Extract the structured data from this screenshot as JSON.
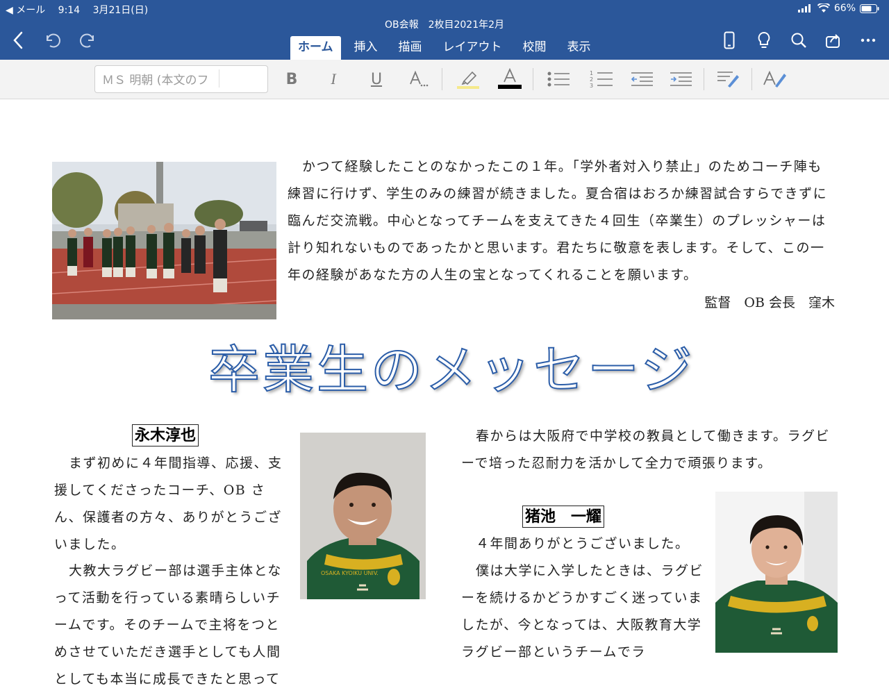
{
  "status_bar": {
    "back_app": "◀ メール",
    "time": "9:14",
    "date": "3月21日(日)",
    "battery": "66%"
  },
  "document": {
    "title": "OB会報　2枚目2021年2月"
  },
  "tabs": [
    {
      "label": "ホーム",
      "active": true
    },
    {
      "label": "挿入",
      "active": false
    },
    {
      "label": "描画",
      "active": false
    },
    {
      "label": "レイアウト",
      "active": false
    },
    {
      "label": "校閲",
      "active": false
    },
    {
      "label": "表示",
      "active": false
    }
  ],
  "ribbon": {
    "font_value": "ＭＳ 明朝 (本文のフ",
    "bold": "B",
    "italic": "I",
    "underline": "U",
    "font_color_letter": "A"
  },
  "content": {
    "intro_text": "かつて経験したことのなかったこの１年。「学外者対入り禁止」のためコーチ陣も練習に行けず、学生のみの練習が続きました。夏合宿はおろか練習試合すらできずに臨んだ交流戦。中心となってチームを支えてきた４回生（卒業生）のプレッシャーは計り知れないものであったかと思います。君たちに敬意を表します。そして、この一年の経験があなた方の人生の宝となってくれることを願います。",
    "signature": "監督　OB 会長　窪木",
    "headline": "卒業生のメッセージ",
    "person1": {
      "name": "永木淳也",
      "text_a": "まず初めに４年間指導、応援、支援してくださったコーチ、OB さん、保護者の方々、ありがとうございました。",
      "text_b": "大教大ラグビー部は選手主体となって活動を行っている素晴らしいチームです。そのチームで主将をつとめさせていただき選手としても人間としても本当に成長できたと思って"
    },
    "continuation": "春からは大阪府で中学校の教員として働きます。ラグビーで培った忍耐力を活かして全力で頑張ります。",
    "person2": {
      "name": "猪池　一耀",
      "text_a": "４年間ありがとうございました。",
      "text_b": "僕は大学に入学したときは、ラグビーを続けるかどうかすごく迷っていましたが、今となっては、大阪教育大学ラグビー部というチームでラ"
    },
    "jersey_text": "OSAKA KYOIKU UNIV."
  },
  "colors": {
    "word_blue": "#2b579a",
    "headline_outline": "#2b5da8",
    "jersey_green": "#1f5a36",
    "jersey_gold": "#d8b021"
  }
}
